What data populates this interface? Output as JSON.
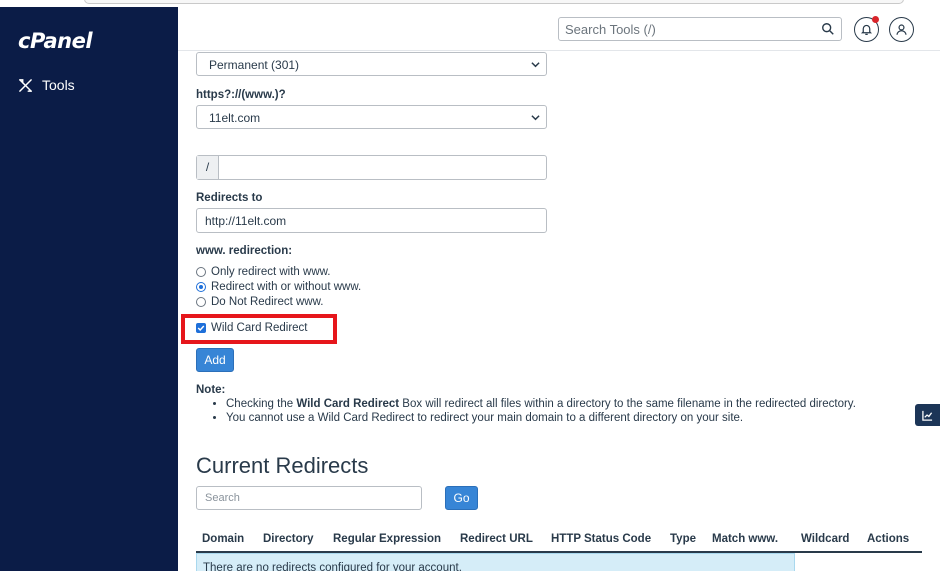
{
  "sidebar": {
    "logo": "cPanel",
    "nav": [
      {
        "label": "Tools",
        "icon": "tools-icon"
      }
    ]
  },
  "topbar": {
    "search_placeholder": "Search Tools (/)",
    "icons": [
      "search-icon",
      "bell-icon",
      "user-icon"
    ],
    "notification_dot_color": "#d9252b"
  },
  "form": {
    "type_select": "Permanent (301)",
    "domain_label": "https?://(www.)?",
    "domain_select": "11elt.com",
    "path_prefix": "/",
    "path_value": "",
    "redirects_to_label": "Redirects to",
    "redirects_to_value": "http://11elt.com",
    "www_label": "www. redirection:",
    "www_options": [
      {
        "label": "Only redirect with www.",
        "selected": false
      },
      {
        "label": "Redirect with or without www.",
        "selected": true
      },
      {
        "label": "Do Not Redirect www.",
        "selected": false
      }
    ],
    "wildcard_label": "Wild Card Redirect",
    "wildcard_checked": true,
    "add_button": "Add"
  },
  "note": {
    "title": "Note:",
    "item1_prefix": "Checking the ",
    "item1_bold": "Wild Card Redirect",
    "item1_suffix": " Box will redirect all files within a directory to the same filename in the redirected directory.",
    "item2": "You cannot use a Wild Card Redirect to redirect your main domain to a different directory on your site."
  },
  "current_redirects": {
    "title": "Current Redirects",
    "search_placeholder": "Search",
    "go_button": "Go",
    "columns": [
      "Domain",
      "Directory",
      "Regular Expression",
      "Redirect URL",
      "HTTP Status Code",
      "Type",
      "Match www.",
      "Wildcard",
      "Actions"
    ],
    "empty_message": "There are no redirects configured for your account."
  },
  "colors": {
    "sidebar_bg": "#0b1c47",
    "primary_button": "#3785d6",
    "highlight_border": "#e6161b",
    "info_row_bg": "#d5edf8"
  }
}
